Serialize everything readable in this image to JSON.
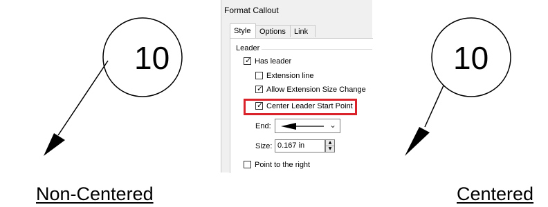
{
  "left_callout": {
    "number": "10",
    "caption": "Non-Centered"
  },
  "right_callout": {
    "number": "10",
    "caption": "Centered"
  },
  "dialog": {
    "title": "Format Callout",
    "tabs": [
      {
        "label": "Style",
        "active": true
      },
      {
        "label": "Options",
        "active": false
      },
      {
        "label": "Link",
        "active": false
      }
    ],
    "group_label": "Leader",
    "options": {
      "has_leader": {
        "label": "Has leader",
        "checked": true
      },
      "extension_line": {
        "label": "Extension line",
        "checked": false
      },
      "allow_extension_size_change": {
        "label": "Allow Extension Size Change",
        "checked": true
      },
      "center_leader_start_point": {
        "label": "Center Leader Start Point",
        "checked": true
      },
      "point_to_right": {
        "label": "Point to the right",
        "checked": false
      }
    },
    "end": {
      "label": "End:",
      "icon": "arrow-left-icon"
    },
    "size": {
      "label": "Size:",
      "value": "0.167 in"
    }
  },
  "colors": {
    "highlight": "#d9222a",
    "dialog_bg": "#f0f0f0"
  }
}
